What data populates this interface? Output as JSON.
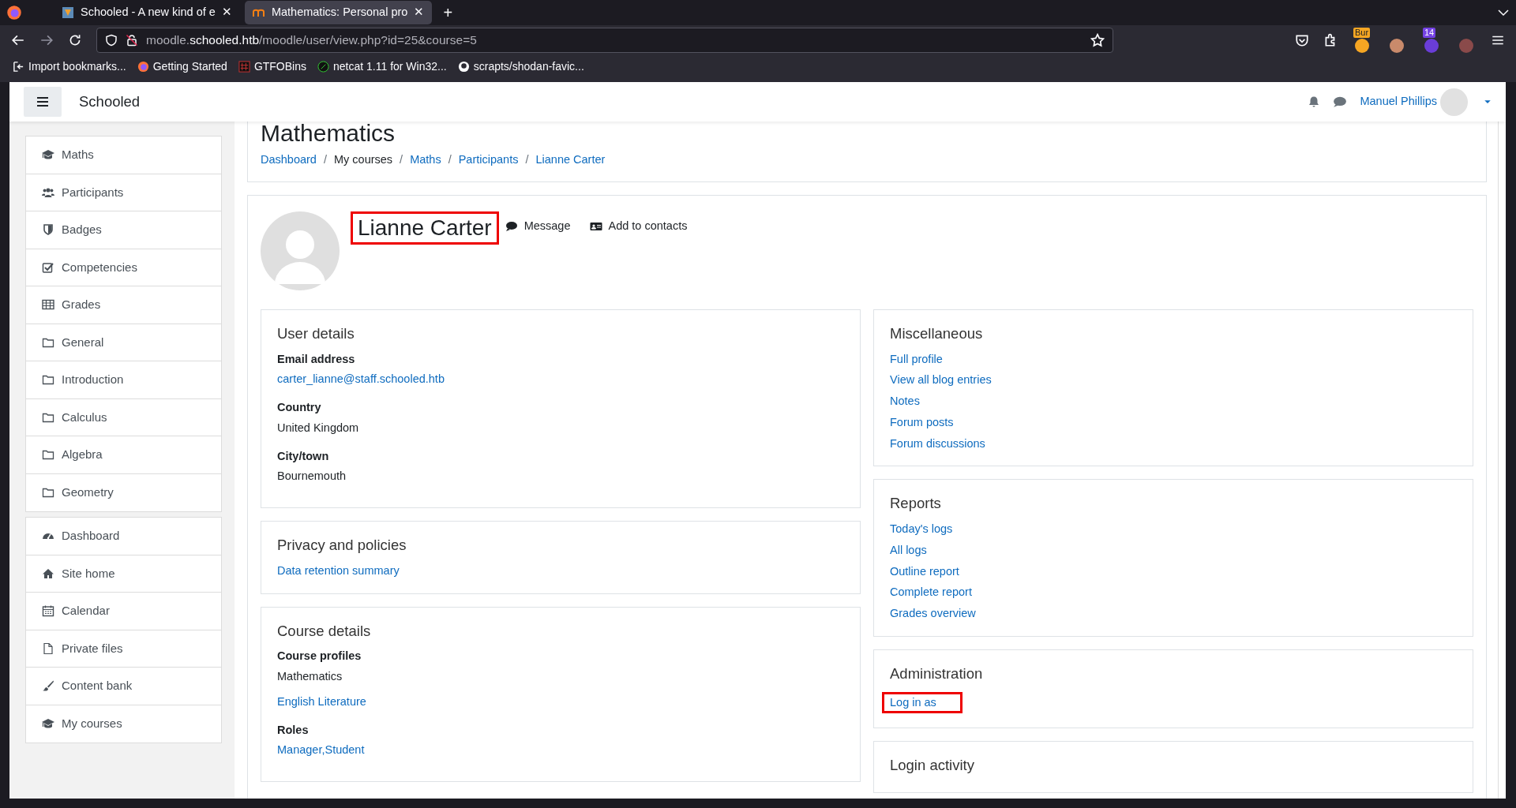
{
  "browser": {
    "tabs": [
      {
        "title": "Schooled - A new kind of e",
        "close": "✕",
        "selected": false
      },
      {
        "title": "Mathematics: Personal pro",
        "close": "✕",
        "selected": true
      }
    ],
    "new_tab": "+",
    "url": {
      "prefix": "moodle.",
      "host": "schooled.htb",
      "path": "/moodle/user/view.php?id=25&course=5"
    },
    "bookmarks": [
      "Import bookmarks...",
      "Getting Started",
      "GTFOBins",
      "netcat 1.11 for Win32...",
      "scrapts/shodan-favic..."
    ],
    "extension_badges": [
      "Bur",
      "14"
    ]
  },
  "navbar": {
    "site_name": "Schooled",
    "user_name": "Manuel Phillips"
  },
  "sidebar": {
    "groups": [
      [
        "Maths",
        "Participants",
        "Badges",
        "Competencies",
        "Grades",
        "General",
        "Introduction",
        "Calculus",
        "Algebra",
        "Geometry"
      ],
      [
        "Dashboard",
        "Site home",
        "Calendar",
        "Private files",
        "Content bank",
        "My courses"
      ]
    ]
  },
  "header": {
    "title": "Mathematics",
    "separator": "/",
    "breadcrumb": [
      {
        "label": "Dashboard",
        "link": true
      },
      {
        "label": "My courses",
        "link": false
      },
      {
        "label": "Maths",
        "link": true
      },
      {
        "label": "Participants",
        "link": true
      },
      {
        "label": "Lianne Carter",
        "link": true
      }
    ]
  },
  "profile": {
    "name": "Lianne Carter",
    "highlighted": true,
    "actions": [
      "Message",
      "Add to contacts"
    ]
  },
  "left_sections": [
    {
      "title": "User details",
      "fields": [
        {
          "label": "Email address",
          "values": [
            {
              "text": "carter_lianne@staff.schooled.htb",
              "link": true
            }
          ]
        },
        {
          "label": "Country",
          "values": [
            {
              "text": "United Kingdom",
              "link": false
            }
          ]
        },
        {
          "label": "City/town",
          "values": [
            {
              "text": "Bournemouth",
              "link": false
            }
          ]
        }
      ]
    },
    {
      "title": "Privacy and policies",
      "links": [
        {
          "text": "Data retention summary",
          "highlighted": false
        }
      ]
    },
    {
      "title": "Course details",
      "fields": [
        {
          "label": "Course profiles",
          "values": [
            {
              "text": "Mathematics",
              "link": false
            },
            {
              "text": "English Literature",
              "link": true
            }
          ]
        },
        {
          "label": "Roles",
          "values": [
            {
              "text": "Manager,Student",
              "link": true
            }
          ]
        }
      ]
    }
  ],
  "right_sections": [
    {
      "title": "Miscellaneous",
      "links": [
        {
          "text": "Full profile",
          "highlighted": false
        },
        {
          "text": "View all blog entries",
          "highlighted": false
        },
        {
          "text": "Notes",
          "highlighted": false
        },
        {
          "text": "Forum posts",
          "highlighted": false
        },
        {
          "text": "Forum discussions",
          "highlighted": false
        }
      ]
    },
    {
      "title": "Reports",
      "links": [
        {
          "text": "Today's logs",
          "highlighted": false
        },
        {
          "text": "All logs",
          "highlighted": false
        },
        {
          "text": "Outline report",
          "highlighted": false
        },
        {
          "text": "Complete report",
          "highlighted": false
        },
        {
          "text": "Grades overview",
          "highlighted": false
        }
      ]
    },
    {
      "title": "Administration",
      "links": [
        {
          "text": "Log in as",
          "highlighted": true
        }
      ]
    },
    {
      "title": "Login activity"
    }
  ]
}
